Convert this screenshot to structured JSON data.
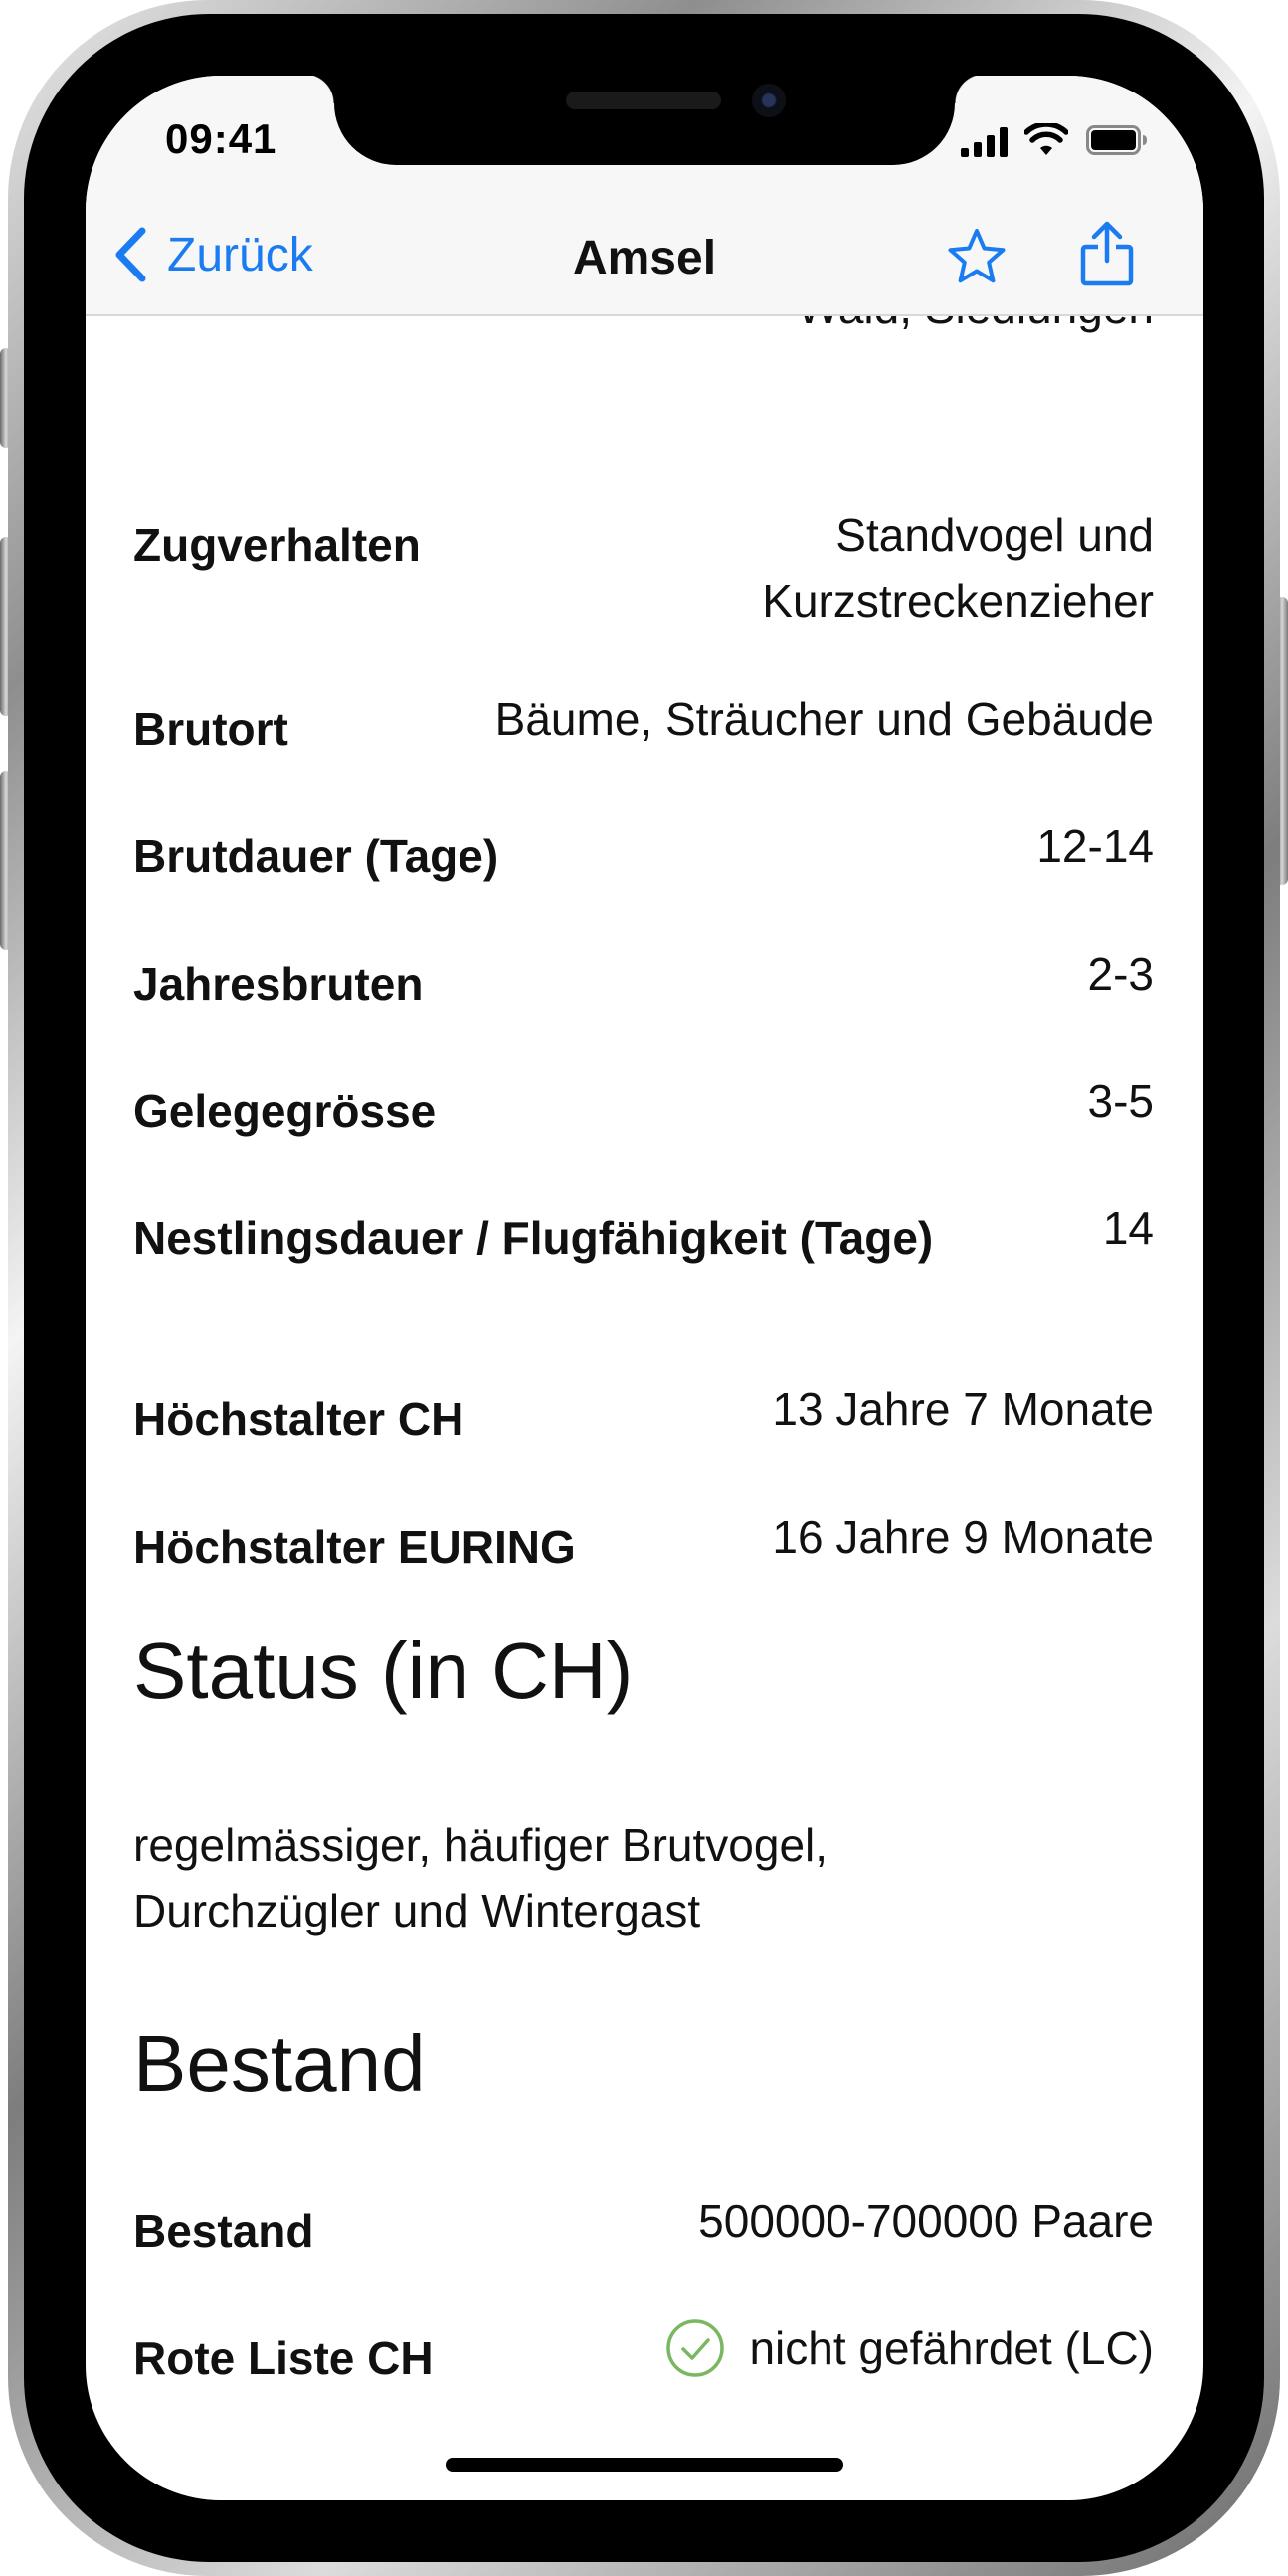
{
  "status_bar": {
    "time": "09:41"
  },
  "nav": {
    "back_label": "Zurück",
    "title": "Amsel",
    "star_icon": "star-outline-icon",
    "share_icon": "share-icon"
  },
  "partial_top_value": "Wald, Siedlungen",
  "details": [
    {
      "label": "Zugverhalten",
      "value_line1": "Standvogel und",
      "value_line2": "Kurzstreckenzieher"
    },
    {
      "label": "Brutort",
      "value": "Bäume, Sträucher und Gebäude"
    },
    {
      "label": "Brutdauer (Tage)",
      "value": "12-14"
    },
    {
      "label": "Jahresbruten",
      "value": "2-3"
    },
    {
      "label": "Gelegegrösse",
      "value": "3-5"
    },
    {
      "label": "Nestlingsdauer / Flugfähigkeit (Tage)",
      "value": "14"
    },
    {
      "label": "Höchstalter CH",
      "value": "13 Jahre 7 Monate"
    },
    {
      "label": "Höchstalter EURING",
      "value": "16 Jahre 9 Monate"
    }
  ],
  "status_section": {
    "heading": "Status (in CH)",
    "text_line1": "regelmässiger, häufiger Brutvogel,",
    "text_line2": "Durchzügler und Wintergast"
  },
  "bestand_section": {
    "heading": "Bestand",
    "rows": [
      {
        "label": "Bestand",
        "value": "500000-700000 Paare"
      },
      {
        "label": "Rote Liste CH",
        "value": "nicht gefährdet (LC)",
        "icon": "check-circle-icon",
        "status_color": "#7bb661"
      }
    ]
  },
  "colors": {
    "accent": "#1a7cf0",
    "text": "#111111",
    "bar_bg": "#f7f7f7"
  }
}
